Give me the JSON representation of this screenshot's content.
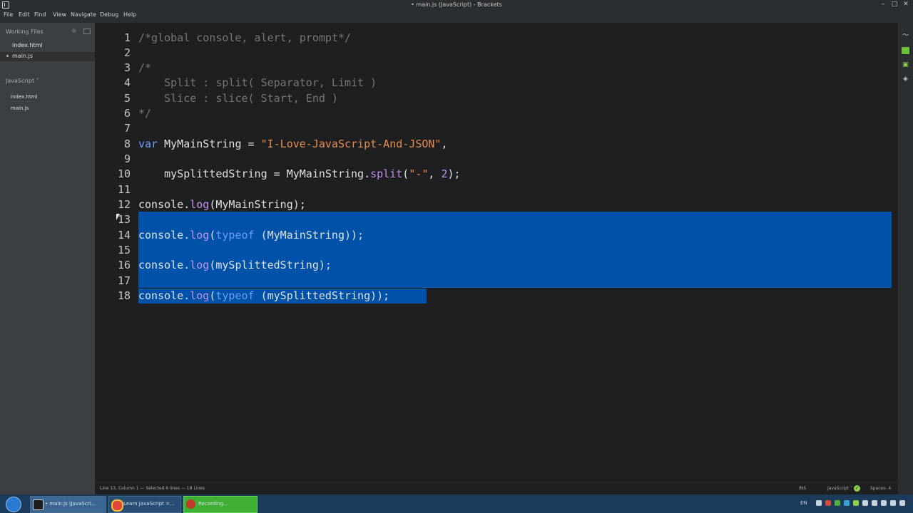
{
  "window": {
    "title": "• main.js (JavaScript) - Brackets",
    "minimize": "–",
    "maximize": "□",
    "close": "✕"
  },
  "menu": [
    "File",
    "Edit",
    "Find",
    "View",
    "Navigate",
    "Debug",
    "Help"
  ],
  "sidebar": {
    "working_files_label": "Working Files",
    "working_files": [
      "index.html",
      "main.js"
    ],
    "project_label": "JavaScript ˅",
    "project_files": [
      "index.html",
      "main.js"
    ]
  },
  "editor": {
    "line_numbers": [
      "1",
      "2",
      "3",
      "4",
      "5",
      "6",
      "7",
      "8",
      "9",
      "10",
      "11",
      "12",
      "13",
      "14",
      "15",
      "16",
      "17",
      "18"
    ],
    "selection": "lines 13-18"
  },
  "status": {
    "left": "Line 13, Column 1 — Selected 6 lines — 18 Lines",
    "ins": "INS",
    "language": "JavaScript ˅",
    "spaces": "Spaces: 4"
  },
  "taskbar": {
    "items": [
      "• main.js (JavaScri...",
      "Learn JavaScript =...",
      "Recording..."
    ],
    "language": "EN"
  },
  "colors": {
    "selection": "#0051a8",
    "keyword": "#6c9ef8",
    "string": "#e88c4b",
    "function": "#c390e8",
    "comment": "#767676"
  }
}
